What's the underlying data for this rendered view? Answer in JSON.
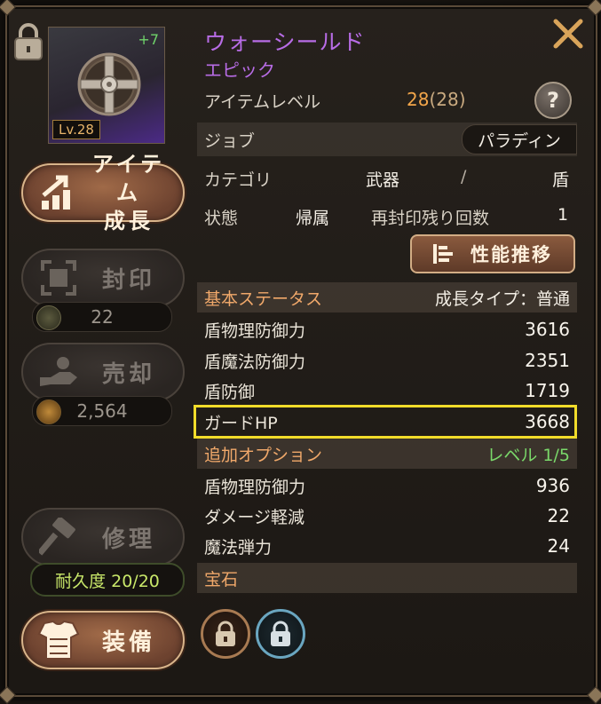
{
  "item": {
    "name": "ウォーシールド",
    "rarity": "エピック",
    "enhance": "+7",
    "level_badge": "Lv.28",
    "item_level_label": "アイテムレベル",
    "item_level": "28",
    "item_level_paren": "(28)"
  },
  "help_label": "?",
  "job": {
    "label": "ジョブ",
    "value": "パラディン"
  },
  "category": {
    "label": "カテゴリ",
    "main": "武器",
    "sep": "/",
    "sub": "盾"
  },
  "state": {
    "label": "状態",
    "value": "帰属",
    "reseal_label": "再封印残り回数",
    "reseal_value": "1"
  },
  "perf_button": "性能推移",
  "basic_section": {
    "label": "基本ステータス",
    "growth": "成長タイプ：普通"
  },
  "basic_stats": [
    {
      "label": "盾物理防御力",
      "value": "3616"
    },
    {
      "label": "盾魔法防御力",
      "value": "2351"
    },
    {
      "label": "盾防御",
      "value": "1719"
    },
    {
      "label": "ガードHP",
      "value": "3668"
    }
  ],
  "extra_section": {
    "label": "追加オプション",
    "level": "レベル 1/5"
  },
  "extra_stats": [
    {
      "label": "盾物理防御力",
      "value": "936"
    },
    {
      "label": "ダメージ軽減",
      "value": "22"
    },
    {
      "label": "魔法弾力",
      "value": "24"
    }
  ],
  "gem_section": {
    "label": "宝石"
  },
  "side": {
    "grow_line1": "アイテム",
    "grow_line2": "成長",
    "seal": "封印",
    "seal_count": "22",
    "sell": "売却",
    "sell_price": "2,564",
    "repair": "修理",
    "durability": "耐久度 20/20",
    "equip": "装備"
  },
  "colors": {
    "epic": "#b86ce6",
    "accent_orange": "#f0a86a",
    "highlight": "#f1dc2a",
    "green": "#7ad86a"
  }
}
